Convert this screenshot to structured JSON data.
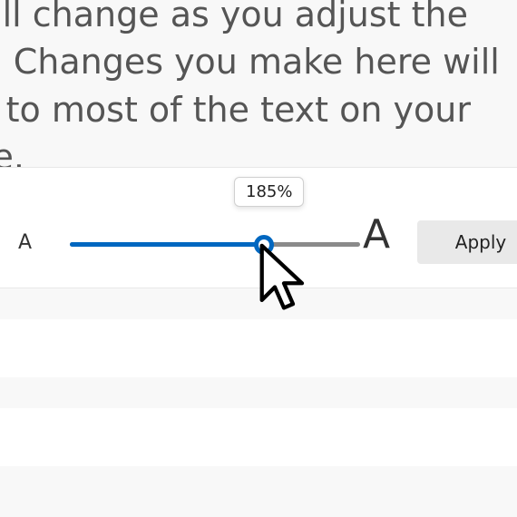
{
  "description_text": "rds will change as you adjust the slider. Changes you make here will apply to most of the text on your device.",
  "slider": {
    "min_label": "A",
    "max_label": "A",
    "tooltip": "185%",
    "percent": 67
  },
  "apply_label": "Apply",
  "colors": {
    "accent": "#0067c0"
  }
}
